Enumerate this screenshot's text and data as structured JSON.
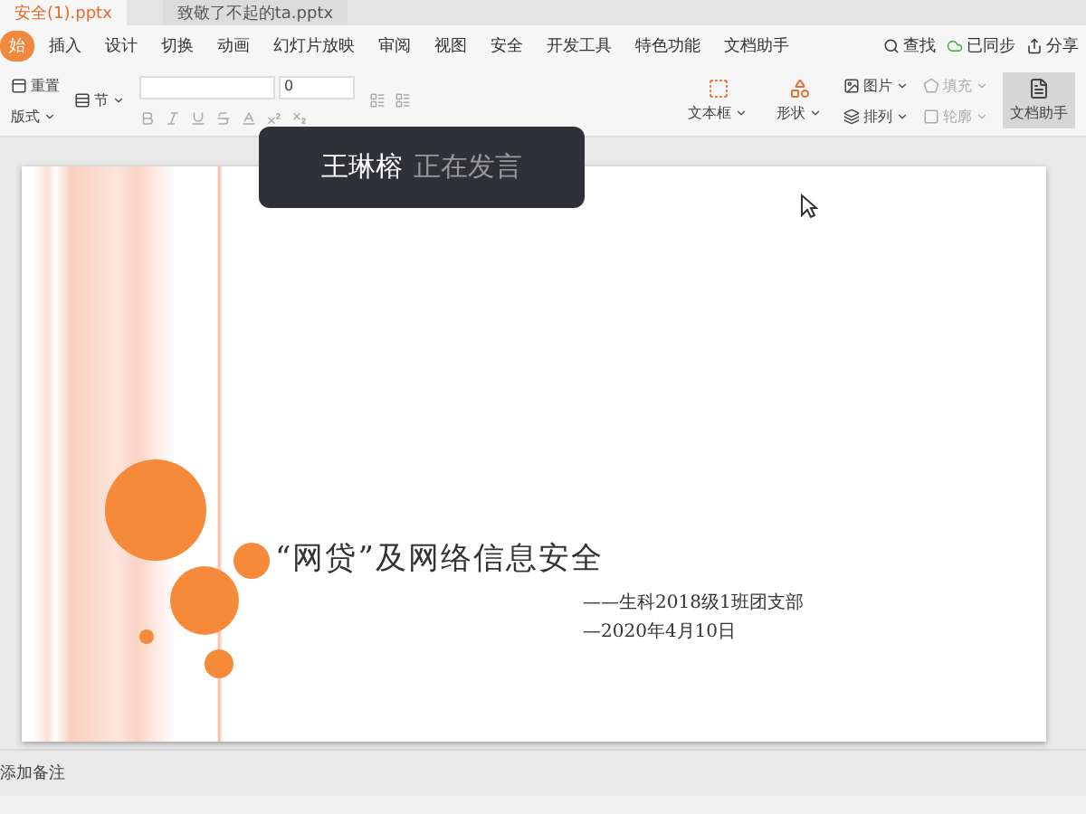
{
  "doc_tabs": [
    {
      "label": "安全(1).pptx",
      "selected": true
    },
    {
      "label": "致敬了不起的ta.pptx",
      "selected": false
    }
  ],
  "menu": [
    {
      "label": "始",
      "selected": true
    },
    {
      "label": "插入",
      "selected": false
    },
    {
      "label": "设计",
      "selected": false
    },
    {
      "label": "切换",
      "selected": false
    },
    {
      "label": "动画",
      "selected": false
    },
    {
      "label": "幻灯片放映",
      "selected": false
    },
    {
      "label": "审阅",
      "selected": false
    },
    {
      "label": "视图",
      "selected": false
    },
    {
      "label": "安全",
      "selected": false
    },
    {
      "label": "开发工具",
      "selected": false
    },
    {
      "label": "特色功能",
      "selected": false
    },
    {
      "label": "文档助手",
      "selected": false
    }
  ],
  "search": {
    "label": "查找"
  },
  "sync": {
    "label": "已同步"
  },
  "share": {
    "label": "分享"
  },
  "toolbar": {
    "reset": "重置",
    "layout": "版式",
    "section": "节",
    "font_size": "0",
    "textbox": "文本框",
    "shape": "形状",
    "picture": "图片",
    "fill": "填充",
    "arrange": "排列",
    "outline": "轮廓",
    "assistant": "文档助手"
  },
  "speaker": {
    "name": "王琳榕",
    "status": "正在发言"
  },
  "slide": {
    "title": "“网贷”及网络信息安全",
    "subtitle": "——生科2018级1班团支部",
    "date": "—2020年4月10日"
  },
  "notes": {
    "placeholder": "添加备注"
  }
}
